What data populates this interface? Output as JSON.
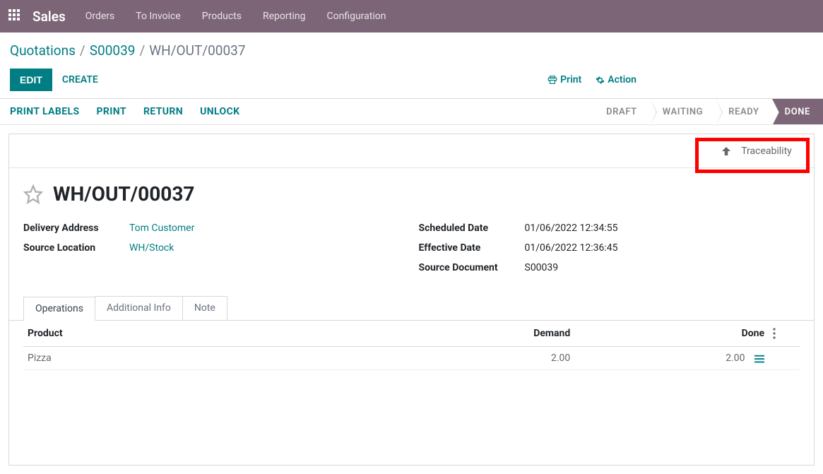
{
  "navbar": {
    "brand": "Sales",
    "links": [
      "Orders",
      "To Invoice",
      "Products",
      "Reporting",
      "Configuration"
    ]
  },
  "breadcrumb": {
    "root": "Quotations",
    "parent": "S00039",
    "current": "WH/OUT/00037"
  },
  "buttons": {
    "edit": "EDIT",
    "create": "CREATE",
    "print": "Print",
    "action": "Action"
  },
  "toolbar": {
    "print_labels": "PRINT LABELS",
    "print": "PRINT",
    "return": "RETURN",
    "unlock": "UNLOCK"
  },
  "status": {
    "draft": "DRAFT",
    "waiting": "WAITING",
    "ready": "READY",
    "done": "DONE"
  },
  "stat_buttons": {
    "traceability": "Traceability"
  },
  "title": "WH/OUT/00037",
  "fields": {
    "delivery_address_label": "Delivery Address",
    "delivery_address_value": "Tom Customer",
    "source_location_label": "Source Location",
    "source_location_value": "WH/Stock",
    "scheduled_date_label": "Scheduled Date",
    "scheduled_date_value": "01/06/2022 12:34:55",
    "effective_date_label": "Effective Date",
    "effective_date_value": "01/06/2022 12:36:45",
    "source_document_label": "Source Document",
    "source_document_value": "S00039"
  },
  "tabs": {
    "operations": "Operations",
    "additional_info": "Additional Info",
    "note": "Note"
  },
  "table": {
    "col_product": "Product",
    "col_demand": "Demand",
    "col_done": "Done",
    "rows": [
      {
        "product": "Pizza",
        "demand": "2.00",
        "done": "2.00"
      }
    ]
  }
}
